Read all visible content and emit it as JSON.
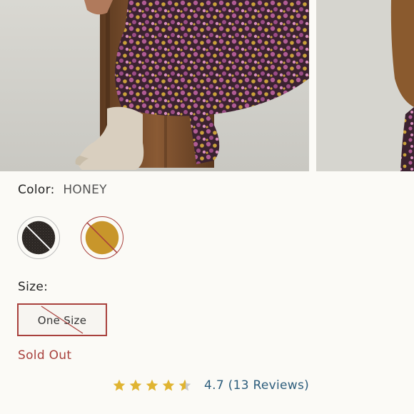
{
  "product": {
    "color_label": "Color:",
    "color_value": "HONEY",
    "swatches": [
      {
        "name": "black",
        "hex": "#2b2623",
        "available": false,
        "selected": false
      },
      {
        "name": "honey",
        "hex": "#c8962b",
        "available": false,
        "selected": true
      }
    ],
    "size_label": "Size:",
    "sizes": [
      {
        "label": "One Size",
        "available": false,
        "selected": true
      }
    ],
    "status": "Sold Out"
  },
  "rating": {
    "stars": 4.7,
    "max_stars": 5,
    "value": "4.7",
    "reviews": "(13 Reviews)"
  },
  "colors": {
    "accent_red": "#a8403c",
    "star_gold": "#e0b431",
    "link_blue": "#2c5d7c"
  },
  "icons": [
    "star-icon",
    "strikethrough-icon"
  ]
}
